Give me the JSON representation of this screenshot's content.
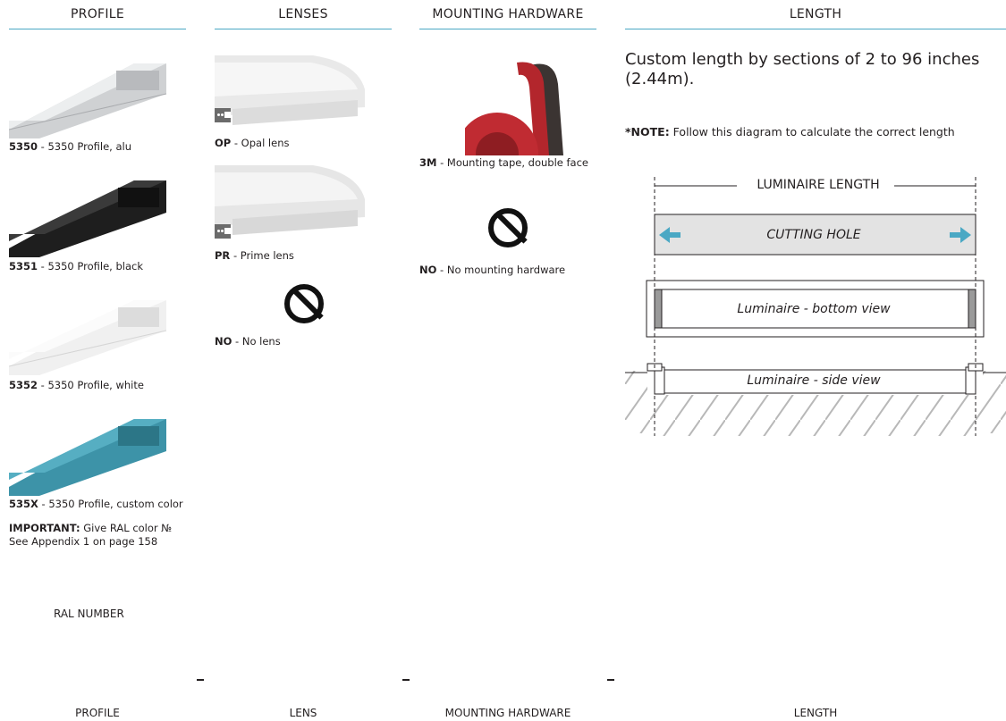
{
  "columns": {
    "profile": "PROFILE",
    "lenses": "LENSES",
    "mounting": "MOUNTING HARDWARE",
    "length": "LENGTH"
  },
  "profiles": [
    {
      "code": "5350",
      "desc": " - 5350 Profile,  alu",
      "color": "#d4d6d8"
    },
    {
      "code": "5351",
      "desc": " - 5350 Profile,  black",
      "color": "#2a2a2a"
    },
    {
      "code": "5352",
      "desc": " - 5350 Profile,  white",
      "color": "#eeeeee"
    },
    {
      "code": "535X",
      "desc": " - 5350 Profile,  custom color",
      "color": "#3d93a8"
    }
  ],
  "important": {
    "label": "IMPORTANT:",
    "text": " Give RAL color №",
    "line2": "See Appendix 1 on page 158"
  },
  "ral_number": "RAL NUMBER",
  "lenses": [
    {
      "code": "OP",
      "desc": " - Opal lens"
    },
    {
      "code": "PR",
      "desc": " - Prime lens"
    },
    {
      "code": "NO",
      "desc": " - No lens"
    }
  ],
  "mounting": [
    {
      "code": "3M",
      "desc": " - Mounting tape, double face"
    },
    {
      "code": "NO",
      "desc": " - No mounting hardware"
    }
  ],
  "length": {
    "description": "Custom length by sections of 2 to 96 inches (2.44m).",
    "note_label": "*NOTE:",
    "note_text": " Follow this diagram to calculate the correct length",
    "diagram": {
      "luminaire_length": "LUMINAIRE LENGTH",
      "cutting_hole": "CUTTING HOLE",
      "bottom_view": "Luminaire - bottom view",
      "side_view": "Luminaire - side view",
      "arrow_color": "#4aa8c4"
    }
  },
  "footer": {
    "profile": "PROFILE",
    "lens": "LENS",
    "mounting": "MOUNTING HARDWARE",
    "length": "LENGTH"
  },
  "accent": "#4aa8c4"
}
